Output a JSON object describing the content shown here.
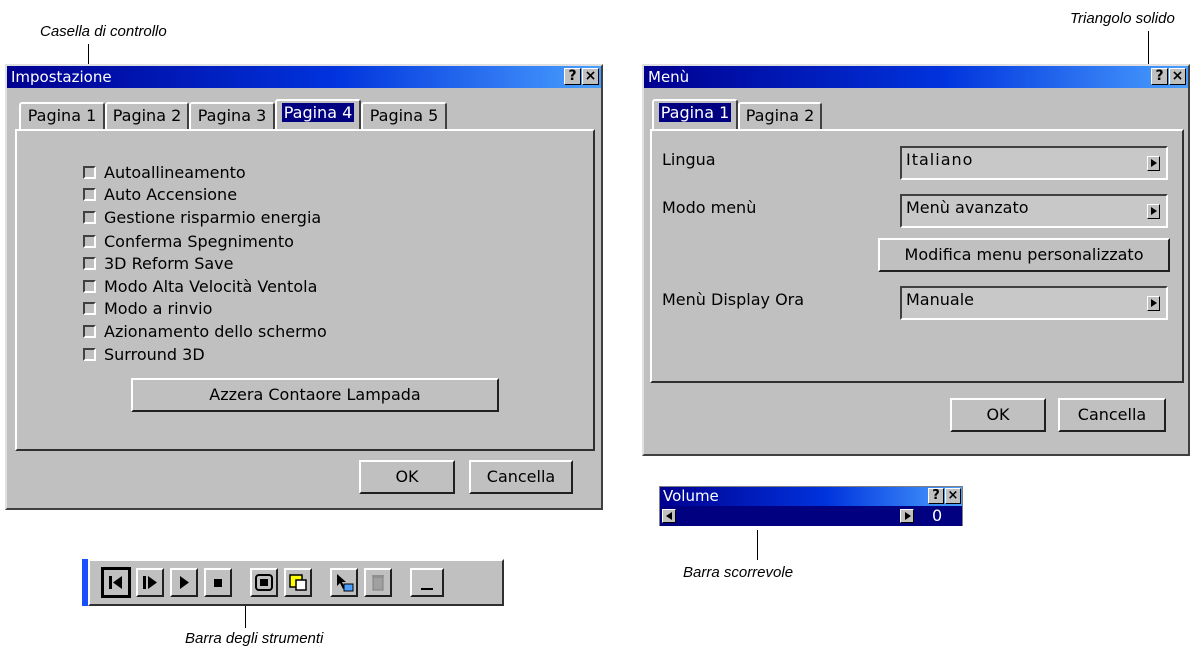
{
  "captions": {
    "checkbox": "Casella di controllo",
    "solid_triangle": "Triangolo solido",
    "scrollbar": "Barra scorrevole",
    "toolbar": "Barra degli strumenti"
  },
  "setup_dialog": {
    "title": "Impostazione",
    "help": "?",
    "close": "×",
    "tabs": [
      "Pagina 1",
      "Pagina 2",
      "Pagina 3",
      "Pagina 4",
      "Pagina 5"
    ],
    "selected_tab": "Pagina 4",
    "options": [
      "Autoallineamento",
      "Auto Accensione",
      "Gestione risparmio energia",
      "Conferma Spegnimento",
      "3D Reform Save",
      "Modo Alta Velocità Ventola",
      "Modo a rinvio",
      "Azionamento dello schermo",
      "Surround 3D"
    ],
    "reset_button": "Azzera Contaore Lampada",
    "ok": "OK",
    "cancel": "Cancella"
  },
  "menu_dialog": {
    "title": "Menù",
    "help": "?",
    "close": "×",
    "tabs": [
      "Pagina 1",
      "Pagina 2"
    ],
    "selected_tab": "Pagina 1",
    "language_label": "Lingua",
    "language_value": "Italiano",
    "menu_mode_label": "Modo menù",
    "menu_mode_value": "Menù avanzato",
    "custom_menu_button": "Modifica menu personalizzato",
    "display_time_label": "Menù Display Ora",
    "display_time_value": "Manuale",
    "ok": "OK",
    "cancel": "Cancella"
  },
  "volume": {
    "title": "Volume",
    "help": "?",
    "close": "×",
    "value": "0"
  },
  "toolbar": {
    "icons": [
      "step-back-icon",
      "step-forward-icon",
      "play-icon",
      "stop-icon",
      "freeze-icon",
      "picture-in-picture-icon",
      "pointer-icon",
      "trash-icon",
      "minimize-icon"
    ]
  },
  "colors": {
    "dialog_bg": "#c0c0c0",
    "titlebar_start": "#000090",
    "titlebar_end": "#4aa0ff",
    "selection": "#000080"
  }
}
